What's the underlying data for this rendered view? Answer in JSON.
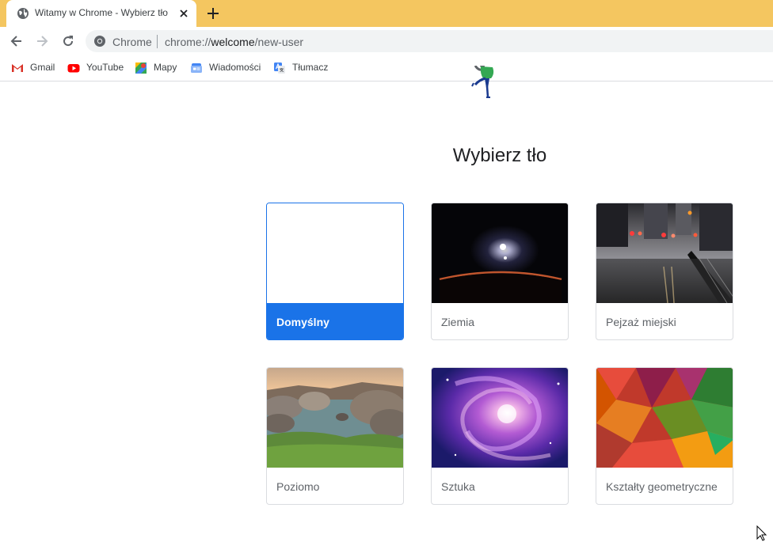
{
  "tab": {
    "title": "Witamy w Chrome - Wybierz tło"
  },
  "omnibox": {
    "chip_label": "Chrome",
    "url_prefix": "chrome://",
    "url_host": "welcome",
    "url_path": "/new-user"
  },
  "bookmarks": [
    {
      "label": "Gmail",
      "icon": "gmail-icon"
    },
    {
      "label": "YouTube",
      "icon": "youtube-icon"
    },
    {
      "label": "Mapy",
      "icon": "maps-icon"
    },
    {
      "label": "Wiadomości",
      "icon": "news-icon"
    },
    {
      "label": "Tłumacz",
      "icon": "translate-icon"
    }
  ],
  "page": {
    "title": "Wybierz tło"
  },
  "backgrounds": [
    {
      "label": "Domyślny",
      "selected": true
    },
    {
      "label": "Ziemia",
      "selected": false
    },
    {
      "label": "Pejzaż miejski",
      "selected": false
    },
    {
      "label": "Poziomo",
      "selected": false
    },
    {
      "label": "Sztuka",
      "selected": false
    },
    {
      "label": "Kształty geometryczne",
      "selected": false
    }
  ],
  "colors": {
    "tabstrip": "#f4c660",
    "accent": "#1a73e8"
  }
}
